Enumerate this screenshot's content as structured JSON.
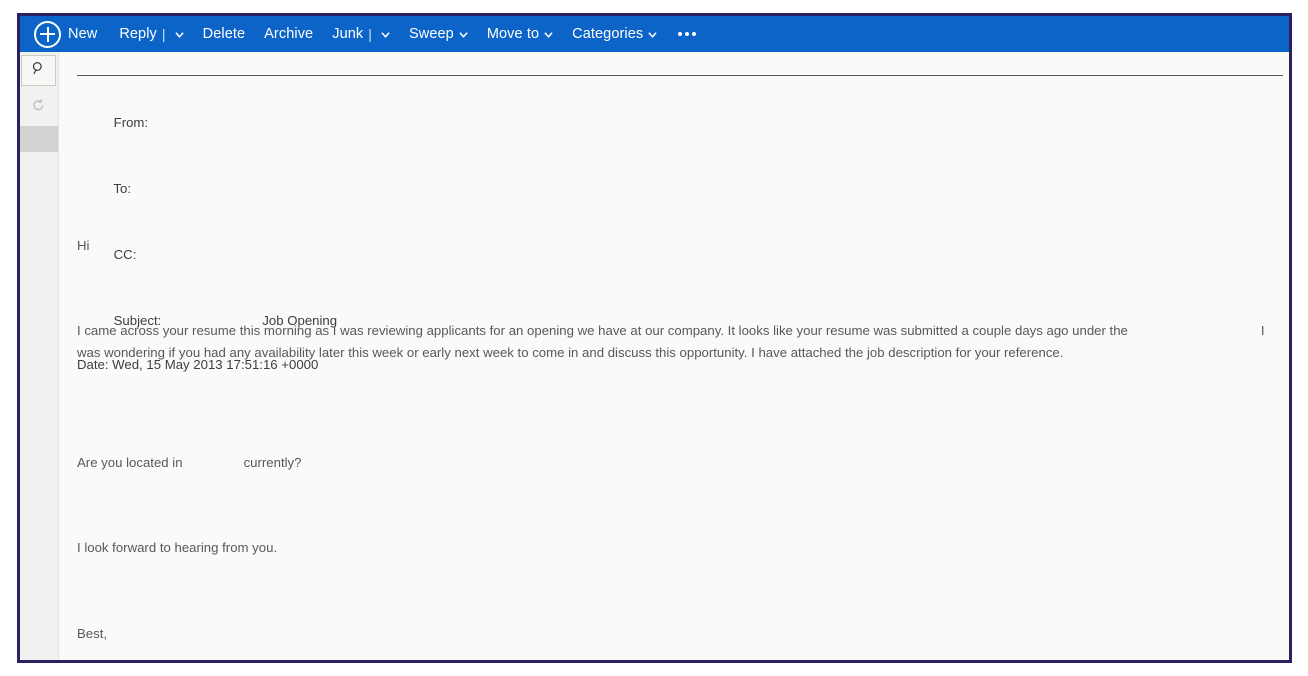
{
  "toolbar": {
    "new_label": "New",
    "reply_label": "Reply",
    "delete_label": "Delete",
    "archive_label": "Archive",
    "junk_label": "Junk",
    "sweep_label": "Sweep",
    "move_to_label": "Move to",
    "categories_label": "Categories",
    "separator": "|",
    "background_color": "#0d64c8",
    "text_color": "#ffffff"
  },
  "sidebar": {
    "search_icon": "search-icon",
    "refresh_icon": "refresh-icon",
    "background_color": "#f1f1ef",
    "selected_block_color": "#d2d2d0"
  },
  "message": {
    "headers": {
      "from_label": "From:",
      "from_value": "",
      "to_label": "To:",
      "to_value": "",
      "cc_label": "CC:",
      "cc_value": "",
      "subject_label": "Subject:",
      "subject_value": "Job Opening",
      "date_line": "Date: Wed, 15 May 2013 17:51:16 +0000"
    },
    "body": {
      "greeting": "Hi",
      "paragraph_1_part_1": "I came across your resume this morning as I was reviewing applicants for an opening we have at our company. It looks like your resume was submitted a couple days ago under the",
      "paragraph_1_part_2": "I was wondering if you had any availability later this week or early next week to come in and discuss this opportunity. I have attached the job description for your reference.",
      "question_part_1": "Are you located in",
      "question_part_2": "currently?",
      "closing_line": "I look forward to hearing from you.",
      "signoff": "Best,"
    }
  },
  "frame": {
    "border_color": "#2b2060",
    "page_background": "#ffffff",
    "pane_background": "#fafaf8"
  }
}
